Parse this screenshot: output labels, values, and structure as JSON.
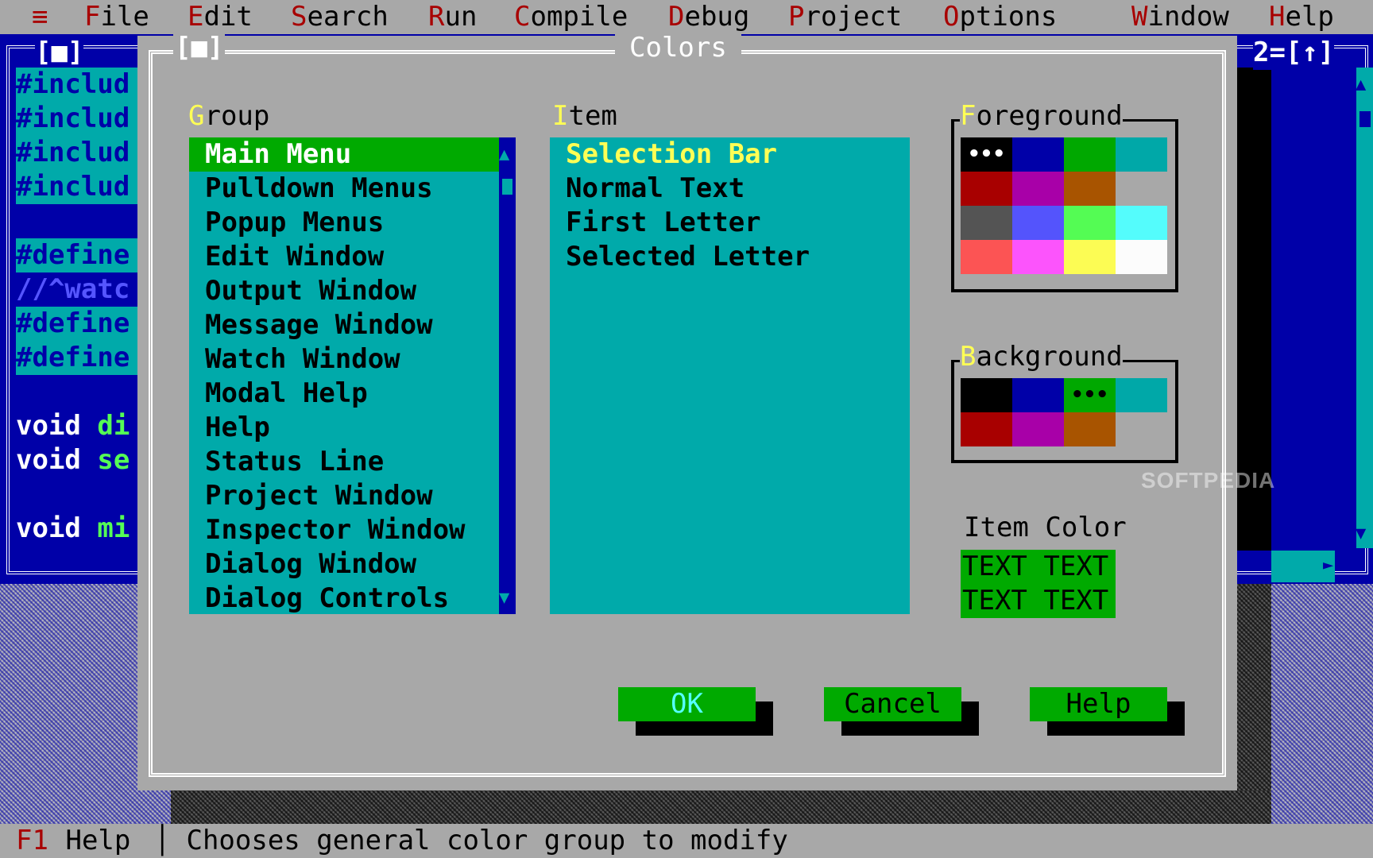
{
  "menubar": {
    "system": "≡",
    "items": [
      {
        "hot": "F",
        "rest": "ile"
      },
      {
        "hot": "E",
        "rest": "dit"
      },
      {
        "hot": "S",
        "rest": "earch"
      },
      {
        "hot": "R",
        "rest": "un"
      },
      {
        "hot": "C",
        "rest": "ompile"
      },
      {
        "hot": "D",
        "rest": "ebug"
      },
      {
        "hot": "P",
        "rest": "roject"
      },
      {
        "hot": "O",
        "rest": "ptions"
      },
      {
        "hot": "W",
        "rest": "indow"
      },
      {
        "hot": "H",
        "rest": "elp"
      }
    ]
  },
  "editor_left": {
    "close_box": "[■]",
    "lines": [
      "#includ",
      "#includ",
      "#includ",
      "#includ",
      "#define",
      "//^watc",
      "#define",
      "#define"
    ],
    "functions": [
      {
        "kw": "void ",
        "name": "di"
      },
      {
        "kw": "void ",
        "name": "se"
      },
      {
        "kw": "void ",
        "name": "mi"
      }
    ]
  },
  "editor_right": {
    "title": "2=[↑]",
    "scroll_up": "▲",
    "scroll_down": "▼",
    "scroll_right": "►"
  },
  "dialog": {
    "title": "Colors",
    "close_box": "[■]",
    "group": {
      "hot": "G",
      "rest": "roup",
      "items": [
        "Main Menu",
        "Pulldown Menus",
        "Popup Menus",
        "Edit Window",
        "Output Window",
        "Message Window",
        "Watch Window",
        "Modal Help",
        "Help",
        "Status Line",
        "Project Window",
        "Inspector Window",
        "Dialog Window",
        "Dialog Controls"
      ],
      "selected_index": 0,
      "scroll_up": "▲",
      "scroll_down": "▼"
    },
    "item": {
      "hot": "I",
      "rest": "tem",
      "items": [
        "Selection Bar",
        "Normal Text",
        "First Letter",
        "Selected Letter"
      ],
      "current_index": 0
    },
    "foreground": {
      "hot": "F",
      "rest": "oreground",
      "colors": [
        "#000000",
        "#0000a8",
        "#00a800",
        "#00a8a8",
        "#a80000",
        "#a800a8",
        "#a85400",
        "#a8a8a8",
        "#545454",
        "#5454fc",
        "#54fc54",
        "#54fcfc",
        "#fc5454",
        "#fc54fc",
        "#fcfc54",
        "#fcfcfc"
      ],
      "marker": "•••",
      "selected_index": 0
    },
    "background": {
      "hot": "B",
      "rest": "ackground",
      "colors": [
        "#000000",
        "#0000a8",
        "#00a800",
        "#00a8a8",
        "#a80000",
        "#a800a8",
        "#a85400",
        "#a8a8a8"
      ],
      "marker": "•••",
      "selected_index": 2
    },
    "item_color": {
      "label": "Item Color",
      "sample_lines": [
        "TEXT TEXT",
        "TEXT TEXT"
      ]
    },
    "buttons": {
      "ok": "OK",
      "cancel": "Cancel",
      "help": "Help"
    }
  },
  "statusbar": {
    "key": "F1",
    "key_label": " Help ",
    "separator": "│",
    "message": " Chooses general color group to modify"
  },
  "watermark": "SOFTPEDIA"
}
